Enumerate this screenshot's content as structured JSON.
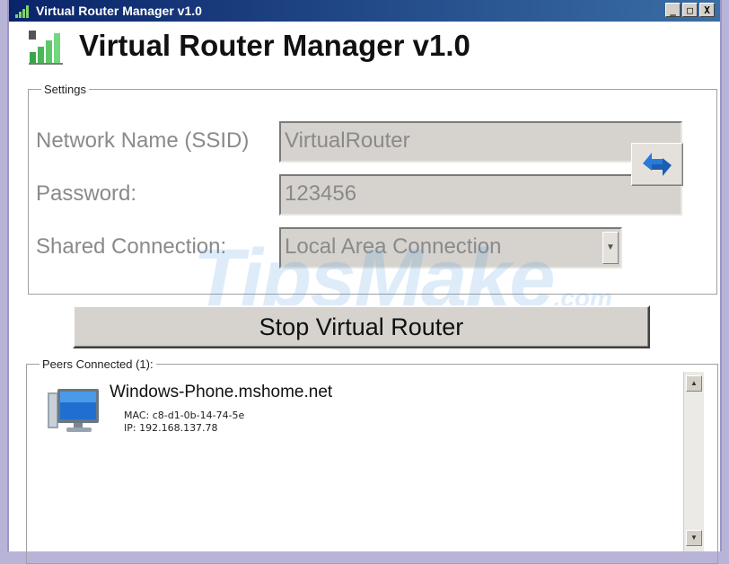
{
  "window": {
    "title": "Virtual Router Manager v1.0",
    "controls": {
      "minimize": "_",
      "maximize": "□",
      "close": "X"
    }
  },
  "header": {
    "title": "Virtual Router Manager v1.0",
    "icon": "signal-bars-icon"
  },
  "settings": {
    "legend": "Settings",
    "ssid": {
      "label": "Network Name (SSID)",
      "value": "VirtualRouter"
    },
    "password": {
      "label": "Password:",
      "value": "123456"
    },
    "shared_connection": {
      "label": "Shared Connection:",
      "value": "Local Area Connection"
    },
    "refresh_icon": "refresh-arrows-icon"
  },
  "main_button": {
    "label": "Stop Virtual Router"
  },
  "peers": {
    "legend": "Peers Connected (1):",
    "items": [
      {
        "name": "Windows-Phone.mshome.net",
        "mac": "MAC: c8-d1-0b-14-74-5e",
        "ip": "IP: 192.168.137.78",
        "icon": "computer-monitor-icon"
      }
    ]
  },
  "watermark": {
    "text": "TipsMake",
    "suffix": ".com"
  },
  "colors": {
    "titlebar": "#0a246a",
    "disabled_text": "#8a8a8a",
    "field_bg": "#d6d3ce"
  }
}
